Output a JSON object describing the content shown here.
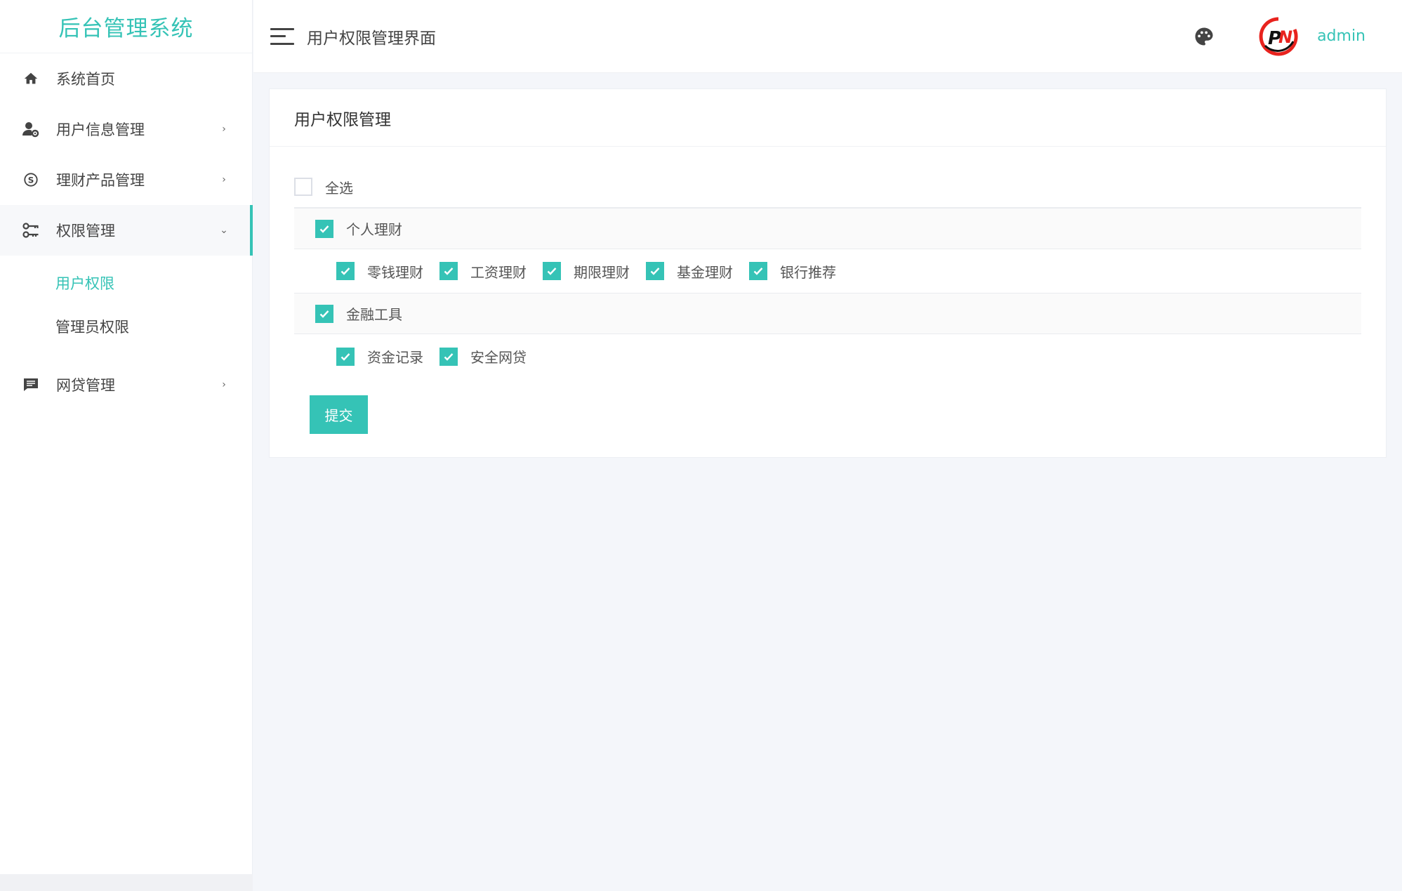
{
  "app": {
    "title": "后台管理系统"
  },
  "sidebar": {
    "items": [
      {
        "label": "系统首页",
        "icon": "home-icon"
      },
      {
        "label": "用户信息管理",
        "icon": "user-gear-icon",
        "arrow": "›"
      },
      {
        "label": "理财产品管理",
        "icon": "skype-icon",
        "arrow": "›"
      },
      {
        "label": "权限管理",
        "icon": "key-icon",
        "arrow": "⌄"
      },
      {
        "label": "网贷管理",
        "icon": "message-icon",
        "arrow": "›"
      }
    ],
    "submenu": [
      {
        "label": "用户权限"
      },
      {
        "label": "管理员权限"
      }
    ]
  },
  "header": {
    "title": "用户权限管理界面",
    "user": "admin"
  },
  "card": {
    "title": "用户权限管理",
    "select_all": "全选",
    "groups": [
      {
        "label": "个人理财",
        "checked": true,
        "children": [
          "零钱理财",
          "工资理财",
          "期限理财",
          "基金理财",
          "银行推荐"
        ]
      },
      {
        "label": "金融工具",
        "checked": true,
        "children": [
          "资金记录",
          "安全网贷"
        ]
      }
    ],
    "submit_label": "提交"
  },
  "colors": {
    "accent": "#35c3b6",
    "background": "#f4f6fa"
  }
}
